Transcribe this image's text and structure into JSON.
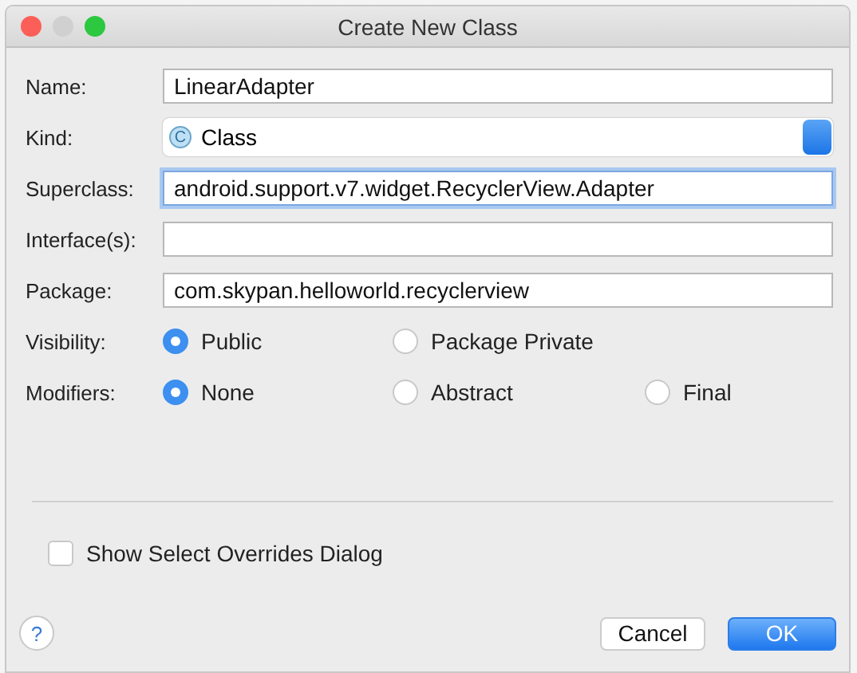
{
  "window": {
    "title": "Create New Class"
  },
  "fields": [
    {
      "kind": "text",
      "label": "Name:",
      "value": "LinearAdapter",
      "focused": false
    },
    {
      "kind": "select",
      "label": "Kind:",
      "value": "Class",
      "icon": "C"
    },
    {
      "kind": "text",
      "label": "Superclass:",
      "value": "android.support.v7.widget.RecyclerView.Adapter",
      "focused": true
    },
    {
      "kind": "text",
      "label": "Interface(s):",
      "focused": false
    },
    {
      "kind": "text",
      "label": "Package:",
      "value": "com.skypan.helloworld.recyclerview",
      "focused": false
    }
  ],
  "radio_groups": [
    {
      "label": "Visibility:",
      "options": [
        {
          "label": "Public",
          "selected": true
        },
        {
          "label": "Package Private",
          "selected": false
        }
      ]
    },
    {
      "label": "Modifiers:",
      "options": [
        {
          "label": "None",
          "selected": true
        },
        {
          "label": "Abstract",
          "selected": false
        },
        {
          "label": "Final",
          "selected": false
        }
      ]
    }
  ],
  "checkbox": {
    "label": "Show Select Overrides Dialog",
    "checked": false
  },
  "help_button": "?",
  "buttons": [
    {
      "label": "Cancel",
      "kind": "secondary"
    },
    {
      "label": "OK",
      "kind": "primary"
    }
  ]
}
